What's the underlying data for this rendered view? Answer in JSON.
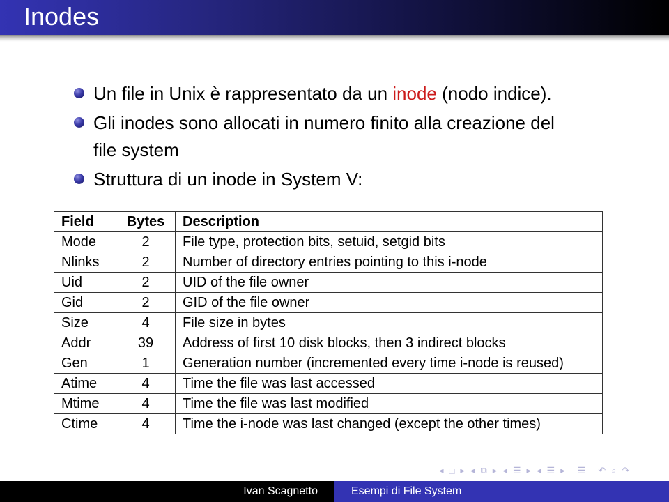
{
  "slide": {
    "title": "Inodes",
    "bullets": [
      {
        "before": "Un file in Unix è rappresentato da un ",
        "highlight": "inode",
        "after": " (nodo indice)."
      },
      {
        "line1": "Gli inodes sono allocati in numero finito alla creazione del",
        "line2": "file system"
      },
      {
        "text": "Struttura di un inode in System V:"
      }
    ],
    "accent_color": "#cc1b1b"
  },
  "table": {
    "headers": [
      "Field",
      "Bytes",
      "Description"
    ],
    "rows": [
      {
        "field": "Mode",
        "bytes": "2",
        "description": "File type, protection bits, setuid, setgid bits"
      },
      {
        "field": "Nlinks",
        "bytes": "2",
        "description": "Number of directory entries pointing to this i-node"
      },
      {
        "field": "Uid",
        "bytes": "2",
        "description": "UID of the file owner"
      },
      {
        "field": "Gid",
        "bytes": "2",
        "description": "GID of the file owner"
      },
      {
        "field": "Size",
        "bytes": "4",
        "description": "File size in bytes"
      },
      {
        "field": "Addr",
        "bytes": "39",
        "description": "Address of first 10 disk blocks, then 3 indirect blocks"
      },
      {
        "field": "Gen",
        "bytes": "1",
        "description": "Generation number (incremented every time i-node is reused)"
      },
      {
        "field": "Atime",
        "bytes": "4",
        "description": "Time the file was last accessed"
      },
      {
        "field": "Mtime",
        "bytes": "4",
        "description": "Time the file was last modified"
      },
      {
        "field": "Ctime",
        "bytes": "4",
        "description": "Time the i-node was last changed (except the other times)"
      }
    ]
  },
  "nav": {
    "icons": [
      "nav-prev-frame",
      "nav-frame-box",
      "nav-next-frame",
      "nav-prev-subsection",
      "nav-subsection-box",
      "nav-next-subsection",
      "nav-prev-section",
      "nav-section-box",
      "nav-next-section",
      "nav-prev-slide",
      "nav-slide-box",
      "nav-next-slide",
      "nav-document",
      "nav-back",
      "nav-search",
      "nav-forward"
    ],
    "glyphs": {
      "prev": "◂",
      "next": "▸",
      "frame": "□",
      "subsection": "⧉",
      "section": "☰",
      "doc": "☰",
      "back": "↶",
      "search": "⌕",
      "forward": "↷"
    }
  },
  "footer": {
    "author": "Ivan Scagnetto",
    "title": "Esempi di File System"
  }
}
